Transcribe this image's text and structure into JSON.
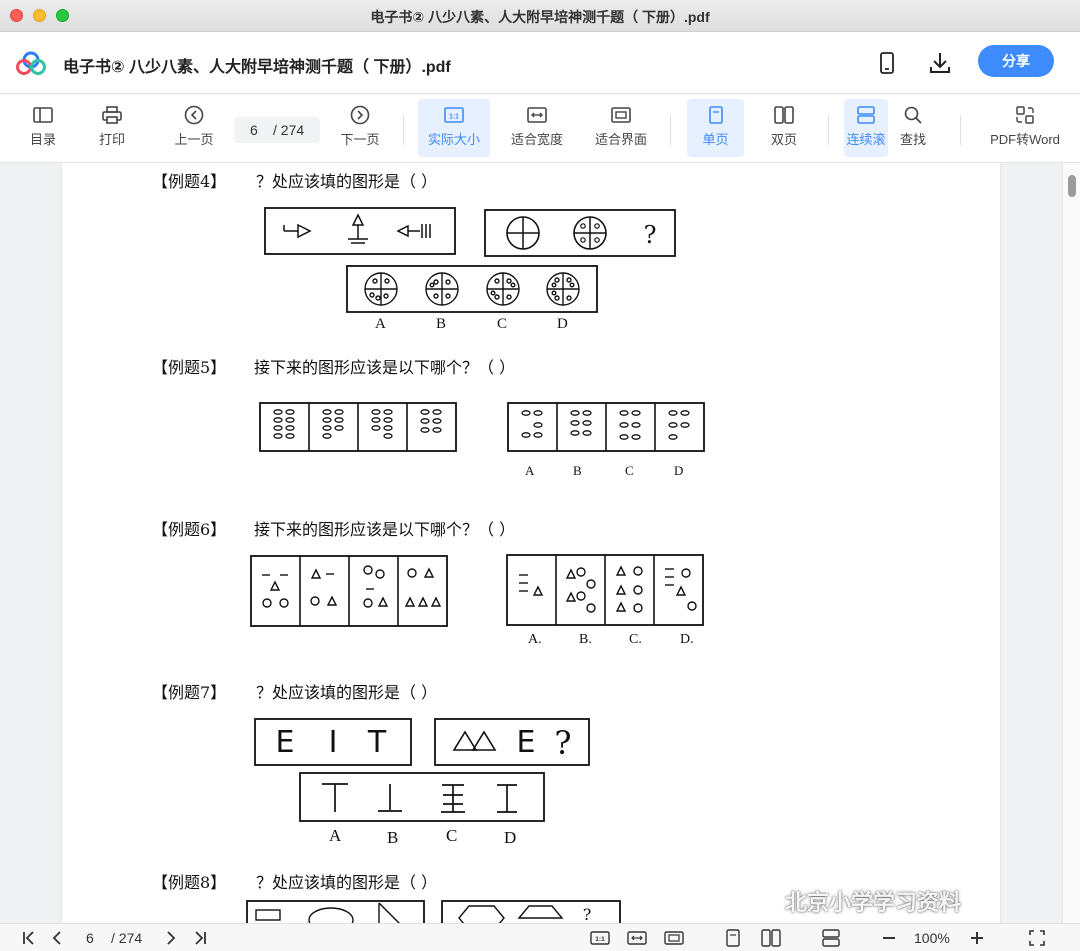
{
  "window": {
    "title": "电子书② 八少八素、人大附早培神测千题（ 下册）.pdf"
  },
  "header": {
    "doc_title": "电子书② 八少八素、人大附早培神测千题（ 下册）.pdf",
    "share_label": "分享"
  },
  "toolbar": {
    "toc": "目录",
    "print": "打印",
    "prev": "上一页",
    "page_current": "6",
    "page_total": "/ 274",
    "next": "下一页",
    "actual_size": "实际大小",
    "fit_width": "适合宽度",
    "fit_page": "适合界面",
    "single": "单页",
    "double": "双页",
    "continuous": "连续滚",
    "find": "查找",
    "pdf_to_word": "PDF转Word"
  },
  "document": {
    "questions": [
      {
        "label": "【例题4】",
        "text": "？处应该填的图形是（    ）",
        "options": [
          "A",
          "B",
          "C",
          "D"
        ]
      },
      {
        "label": "【例题5】",
        "text": "接下来的图形应该是以下哪个？（    ）",
        "options": [
          "A",
          "B",
          "C",
          "D"
        ]
      },
      {
        "label": "【例题6】",
        "text": "接下来的图形应该是以下哪个？（    ）",
        "options": [
          "A.",
          "B.",
          "C.",
          "D."
        ]
      },
      {
        "label": "【例题7】",
        "text": "？处应该填的图形是（    ）",
        "options": [
          "A",
          "B",
          "C",
          "D"
        ],
        "top_row": [
          "E",
          "I",
          "T"
        ],
        "second_row": [
          "E",
          "?"
        ]
      },
      {
        "label": "【例题8】",
        "text": "？处应该填的图形是（    ）"
      }
    ],
    "q4_question_mark": "?",
    "q8_question_mark": "?"
  },
  "watermark": "北京小学学习资料",
  "bottombar": {
    "page_current": "6",
    "page_total": "/ 274",
    "zoom": "100%"
  },
  "colors": {
    "accent": "#3d8bfd",
    "active_bg": "#e7f0ff"
  }
}
